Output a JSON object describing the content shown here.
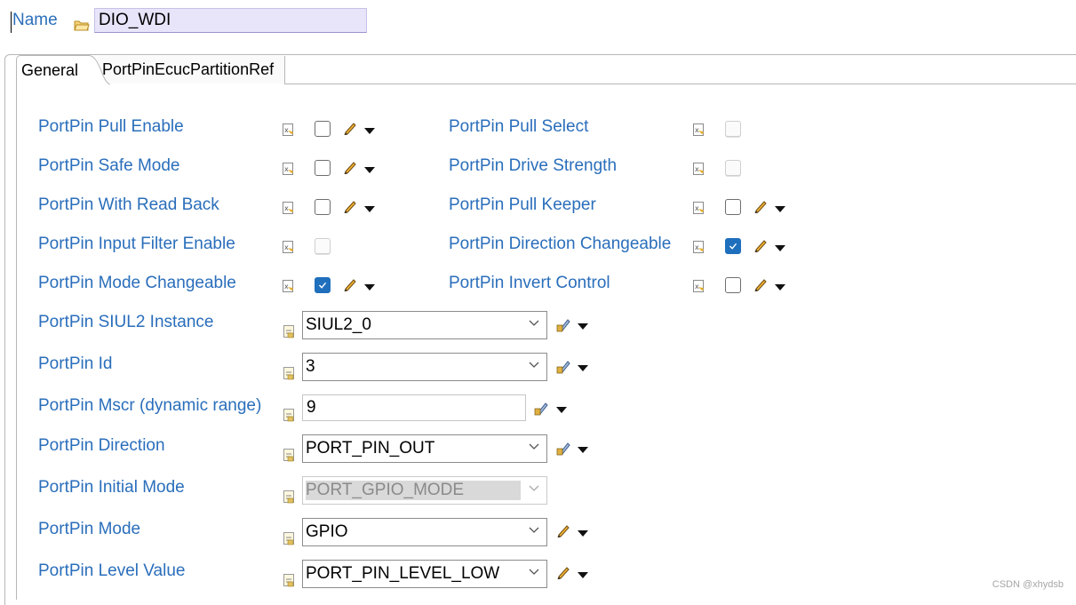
{
  "name": {
    "label": "Name",
    "value": "DIO_WDI"
  },
  "tabs": [
    {
      "label": "General",
      "active": true
    },
    {
      "label": "PortPinEcucPartitionRef",
      "active": false
    }
  ],
  "checkbox_params": [
    {
      "label": "PortPin Pull Enable",
      "checked": false,
      "enabled": true
    },
    {
      "label": "PortPin Safe Mode",
      "checked": false,
      "enabled": true
    },
    {
      "label": "PortPin With Read Back",
      "checked": false,
      "enabled": true
    },
    {
      "label": "PortPin Input Filter Enable",
      "checked": false,
      "enabled": false
    },
    {
      "label": "PortPin Mode Changeable",
      "checked": true,
      "enabled": true
    },
    {
      "label": "PortPin Pull Select",
      "checked": false,
      "enabled": false
    },
    {
      "label": "PortPin Drive Strength",
      "checked": false,
      "enabled": false
    },
    {
      "label": "PortPin Pull Keeper",
      "checked": false,
      "enabled": true
    },
    {
      "label": "PortPin Direction Changeable",
      "checked": true,
      "enabled": true
    },
    {
      "label": "PortPin Invert Control",
      "checked": false,
      "enabled": true
    }
  ],
  "value_params": [
    {
      "label": "PortPin SIUL2 Instance",
      "value": "SIUL2_0",
      "kind": "combo",
      "enabled": true
    },
    {
      "label": "PortPin Id",
      "value": "3",
      "kind": "combo",
      "enabled": true
    },
    {
      "label": "PortPin Mscr (dynamic range)",
      "value": "9",
      "kind": "text",
      "enabled": true
    },
    {
      "label": "PortPin Direction",
      "value": "PORT_PIN_OUT",
      "kind": "combo",
      "enabled": true
    },
    {
      "label": "PortPin Initial Mode",
      "value": "PORT_GPIO_MODE",
      "kind": "combo",
      "enabled": false
    },
    {
      "label": "PortPin Mode",
      "value": "GPIO",
      "kind": "combo",
      "enabled": true
    },
    {
      "label": "PortPin Level Value",
      "value": "PORT_PIN_LEVEL_LOW",
      "kind": "combo",
      "enabled": true
    }
  ],
  "watermark": "CSDN @xhydsb",
  "colors": {
    "label": "#2a6ebb",
    "checked": "#1f6fbd",
    "name_field_bg": "#e8e5fb"
  }
}
